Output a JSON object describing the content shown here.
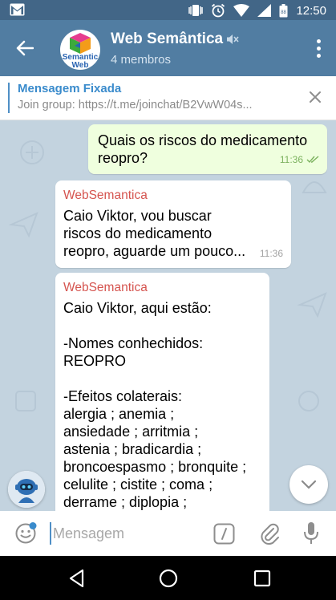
{
  "status_bar": {
    "time": "12:50"
  },
  "header": {
    "title": "Web Semântica",
    "subtitle": "4 membros",
    "avatar_logo": [
      "Semantic",
      "Web"
    ]
  },
  "pinned": {
    "title": "Mensagem Fixada",
    "text": "Join group: https://t.me/joinchat/B2VwW04s..."
  },
  "messages": [
    {
      "direction": "out",
      "text": "Quais os riscos do medicamento\nreopro?",
      "time": "11:36",
      "status": "read"
    },
    {
      "direction": "in",
      "sender": "WebSemantica",
      "text": "Caio Viktor, vou buscar\nriscos do medicamento\nreopro, aguarde um pouco...",
      "time": "11:36"
    },
    {
      "direction": "in",
      "sender": "WebSemantica",
      "text": "Caio Viktor, aqui estão:\n\n-Nomes conhechidos:\nREOPRO\n\n-Efeitos colaterais:\nalergia ; anemia ;\nansiedade ; arritmia ;\nastenia ; bradicardia ;\nbroncoespasmo ; bronquite ;\ncelulite ; cistite ; coma ;\nderrame ; diplopia ;"
    }
  ],
  "composer": {
    "placeholder": "Mensagem"
  },
  "colors": {
    "header": "#517da2",
    "status_bar": "#426687",
    "accent": "#4f8fc6",
    "out_bubble": "#efffde",
    "sender": "#d5544f",
    "chat_bg": "#c3d3df"
  },
  "icons": {
    "back": "arrow-left-icon",
    "mute": "muted-speaker-icon",
    "menu": "more-vertical-icon",
    "close": "close-icon",
    "emoji": "emoji-icon",
    "bot": "bot-icon",
    "scroll": "chevron-down-icon",
    "command": "slash-command-icon",
    "attach": "paperclip-icon",
    "mic": "microphone-icon",
    "nav_back": "triangle-back-icon",
    "nav_home": "circle-home-icon",
    "nav_recent": "square-recent-icon"
  }
}
